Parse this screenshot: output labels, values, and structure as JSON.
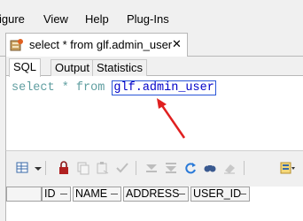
{
  "menu": {
    "items": [
      "igure",
      "View",
      "Help",
      "Plug-Ins"
    ]
  },
  "tab": {
    "label": "select * from glf.admin_user",
    "close": "✕",
    "icon": "query-tab-icon"
  },
  "subtabs": {
    "items": [
      "SQL",
      "Output",
      "Statistics"
    ],
    "active": "SQL"
  },
  "editor": {
    "sql_prefix": "select * from ",
    "sql_table": "glf.admin_user",
    "keyword_color": "#5f9ea0",
    "table_color": "#0000c8",
    "arrow_color": "#e02020"
  },
  "toolbar": {
    "icons": [
      "grid-options-icon",
      "dropdown-arrow-icon",
      "lock-icon",
      "copy-icon",
      "paste-icon",
      "check-icon",
      "first-record-icon",
      "last-record-icon",
      "refresh-icon",
      "find-icon",
      "clear-icon",
      "export-icon"
    ]
  },
  "grid": {
    "columns": [
      "ID",
      "NAME",
      "ADDRESS",
      "USER_ID"
    ]
  }
}
